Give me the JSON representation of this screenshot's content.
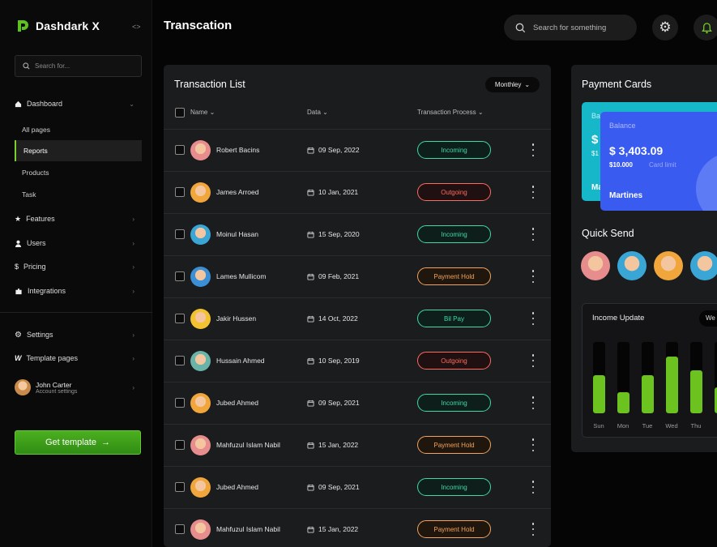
{
  "brand": {
    "name": "Dashdark X"
  },
  "sidebar": {
    "search_placeholder": "Search for...",
    "dashboard_label": "Dashboard",
    "sub_items": [
      "All pages",
      "Reports",
      "Products",
      "Task"
    ],
    "active_sub": "Reports",
    "nav": [
      "Features",
      "Users",
      "Pricing",
      "Integrations"
    ],
    "settings_label": "Settings",
    "template_pages_label": "Template pages",
    "user_name": "John Carter",
    "user_sub": "Account settings",
    "cta_label": "Get template"
  },
  "header": {
    "title": "Transcation",
    "search_placeholder": "Search for something"
  },
  "transactions": {
    "title": "Transaction List",
    "filter": "Monthley",
    "columns": {
      "name": "Name",
      "date": "Data",
      "process": "Transaction Process"
    },
    "rows": [
      {
        "name": "Robert Bacins",
        "date": "09 Sep, 2022",
        "status": "Incoming",
        "kind": "green",
        "avatar": "#e88d8d"
      },
      {
        "name": "James Arroed",
        "date": "10 Jan, 2021",
        "status": "Outgoing",
        "kind": "red",
        "avatar": "#f0a63a"
      },
      {
        "name": "Moinul Hasan",
        "date": "15 Sep, 2020",
        "status": "Incoming",
        "kind": "green",
        "avatar": "#3aa6d6"
      },
      {
        "name": "Lames Mullicom",
        "date": "09 Feb, 2021",
        "status": "Payment Hold",
        "kind": "orange",
        "avatar": "#3a8fd6"
      },
      {
        "name": "Jakir Hussen",
        "date": "14 Oct, 2022",
        "status": "Bil Pay",
        "kind": "green",
        "avatar": "#f2c230"
      },
      {
        "name": "Hussain Ahmed",
        "date": "10 Sep, 2019",
        "status": "Outgoing",
        "kind": "red",
        "avatar": "#6ab3a8"
      },
      {
        "name": "Jubed Ahmed",
        "date": "09 Sep, 2021",
        "status": "Incoming",
        "kind": "green",
        "avatar": "#f0a63a"
      },
      {
        "name": "Mahfuzul Islam Nabil",
        "date": "15 Jan, 2022",
        "status": "Payment Hold",
        "kind": "orange",
        "avatar": "#e88d8d"
      },
      {
        "name": "Jubed Ahmed",
        "date": "09 Sep, 2021",
        "status": "Incoming",
        "kind": "green",
        "avatar": "#f0a63a"
      },
      {
        "name": "Mahfuzul Islam Nabil",
        "date": "15 Jan, 2022",
        "status": "Payment Hold",
        "kind": "orange",
        "avatar": "#e88d8d"
      }
    ]
  },
  "payment_cards": {
    "title": "Payment Cards",
    "back_label": "Ba",
    "back_amount": "$",
    "back_sub": "$1",
    "back_holder": "Ma",
    "balance_label": "Balance",
    "balance": "$ 3,403.09",
    "limit_value": "$10.000",
    "limit_label": "Card limit",
    "holder": "Martines"
  },
  "quick_send": {
    "title": "Quick Send",
    "avatars": [
      "#e88d8d",
      "#3aa6d6",
      "#f0a63a",
      "#3aa6d6"
    ]
  },
  "income": {
    "title": "Income Update",
    "filter": "We",
    "days": [
      "Sun",
      "Mon",
      "Tue",
      "Wed",
      "Thu",
      "F"
    ],
    "levels": [
      0.53,
      0.3,
      0.53,
      0.79,
      0.6,
      0.36
    ]
  },
  "colors": {
    "accent": "#6cc21f",
    "card_blue": "#3a5bf0",
    "card_cyan": "#15b7c8"
  }
}
